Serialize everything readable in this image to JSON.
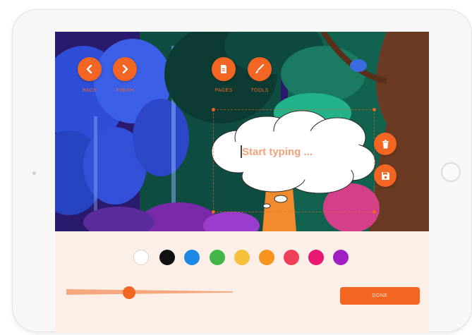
{
  "toolbar": {
    "back_label": "BACK",
    "finish_label": "FINISH",
    "pages_label": "PAGES",
    "tools_label": "TOOLS"
  },
  "editor": {
    "placeholder": "Start typing ..."
  },
  "palette": {
    "colors": [
      "#ffffff",
      "#111111",
      "#1e88e5",
      "#43b649",
      "#f6c23e",
      "#f7931e",
      "#ef3f56",
      "#e8176f",
      "#a020c4"
    ]
  },
  "slider": {
    "value": 0.4
  },
  "done_label": "DONE",
  "accent": "#f26522"
}
